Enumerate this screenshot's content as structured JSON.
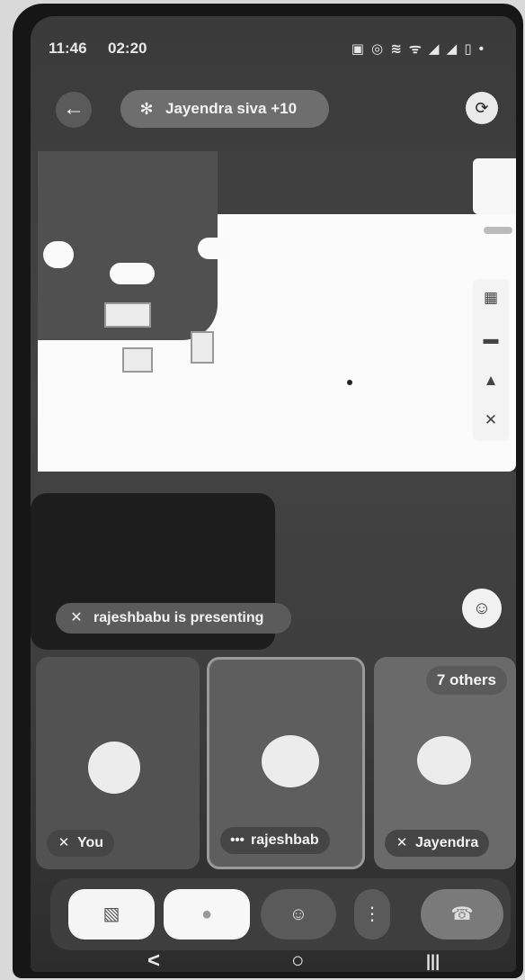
{
  "status_bar": {
    "time": "11:46",
    "call_timer": "02:20",
    "icons_text": "▣ ◎ ≋ ᯤ ◢ ◢ ▯ •"
  },
  "header": {
    "back_icon": "←",
    "title": "Jayendra siva +10",
    "title_icon": "✻",
    "switch_camera_icon": "⟳"
  },
  "presentation": {
    "toolbar_icons": [
      "▦",
      "▬",
      "▲",
      "✕"
    ]
  },
  "presenting": {
    "label": "rajeshbabu is presenting",
    "mic_off_icon": "✕",
    "reactions_icon": "☺"
  },
  "participants": [
    {
      "name": "You",
      "mic_off_icon": "✕"
    },
    {
      "name": "rajeshbab",
      "speaking_icon": "•••"
    },
    {
      "name": "Jayendra",
      "mic_off_icon": "✕"
    }
  ],
  "others_badge": "7 others",
  "controls": {
    "camera_icon": "▧",
    "mic_icon": "●",
    "emoji_icon": "☺",
    "more_icon": "⋮",
    "hangup_icon": "☎"
  },
  "nav": {
    "back": "<",
    "home": "○",
    "recents": "|||"
  }
}
